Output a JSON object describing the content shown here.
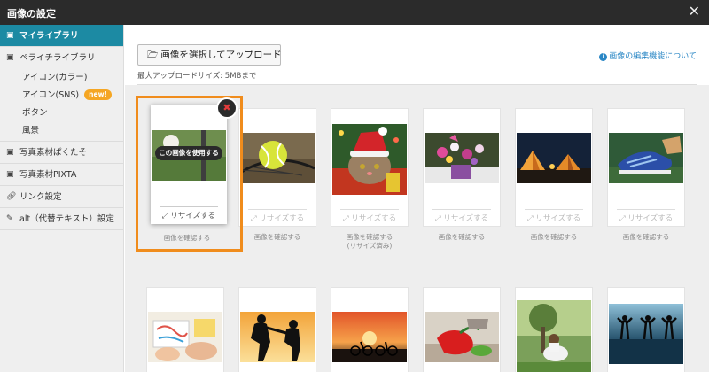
{
  "dialog": {
    "title": "画像の設定"
  },
  "sidebar": {
    "items": [
      {
        "label": "マイライブラリ"
      },
      {
        "label": "ペライチライブラリ"
      },
      {
        "label": "写真素材ぱくたそ"
      },
      {
        "label": "写真素材PIXTA"
      },
      {
        "label": "リンク設定"
      },
      {
        "label": "alt（代替テキスト）設定"
      }
    ],
    "sub_items": [
      {
        "label": "アイコン(カラー)"
      },
      {
        "label": "アイコン(SNS)"
      },
      {
        "label": "ボタン"
      },
      {
        "label": "風景"
      }
    ],
    "new_badge": "new!"
  },
  "toolbar": {
    "upload_label": "画像を選択してアップロード",
    "max_size": "最大アップロードサイズ: 5MBまで",
    "edit_link": "画像の編集機能について"
  },
  "grid": {
    "use_label": "この画像を使用する",
    "resize_label": "リサイズする",
    "confirm_label": "画像を確認する",
    "resized_note": "(リサイズ済み)"
  },
  "colors": {
    "accent": "#1c8aa3",
    "selection": "#f08c1c",
    "badge": "#f5a623",
    "link": "#2a87c5"
  }
}
